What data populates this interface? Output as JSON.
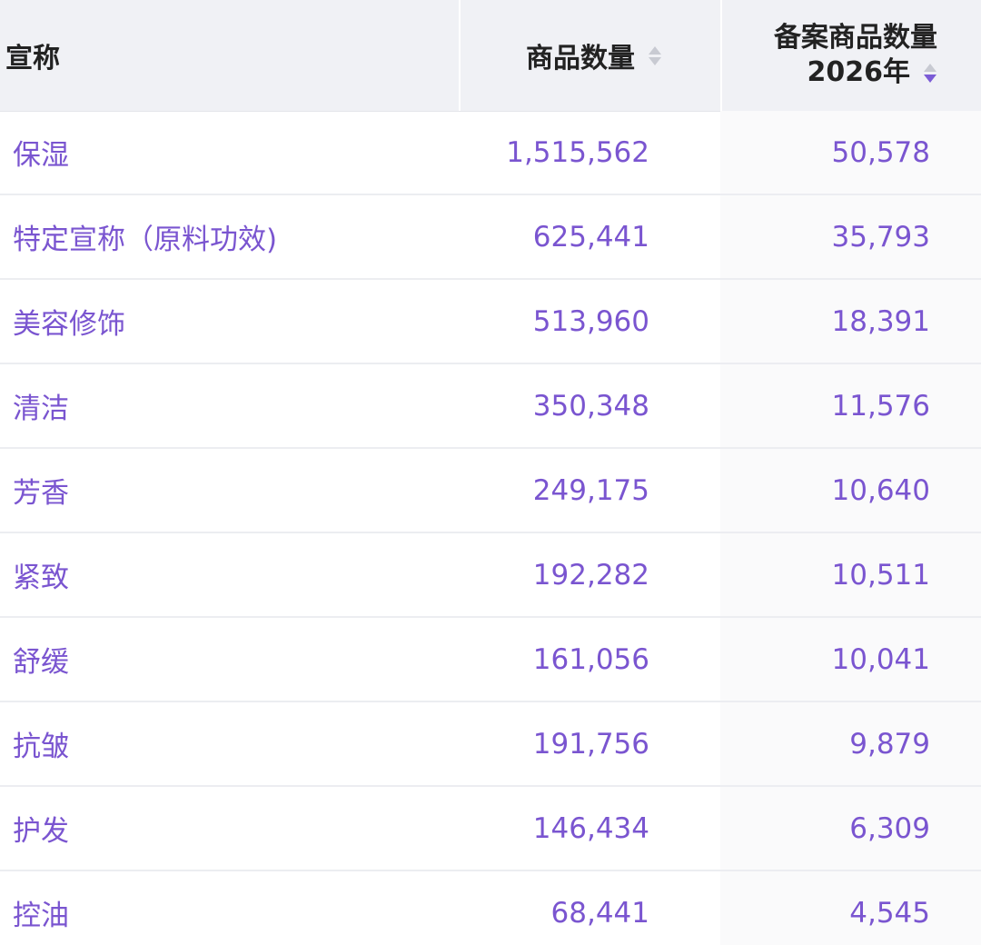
{
  "table": {
    "columns": {
      "claim": "宣称",
      "product_count": "商品数量",
      "filed_product_count_line1": "备案商品数量",
      "filed_product_count_line2": "2026年"
    },
    "sort": {
      "column": "filed_product_count",
      "direction": "descending"
    },
    "rows": [
      {
        "claim": "保湿",
        "product_count": "1,515,562",
        "filed_product_count": "50,578"
      },
      {
        "claim": "特定宣称（原料功效)",
        "product_count": "625,441",
        "filed_product_count": "35,793"
      },
      {
        "claim": "美容修饰",
        "product_count": "513,960",
        "filed_product_count": "18,391"
      },
      {
        "claim": "清洁",
        "product_count": "350,348",
        "filed_product_count": "11,576"
      },
      {
        "claim": "芳香",
        "product_count": "249,175",
        "filed_product_count": "10,640"
      },
      {
        "claim": "紧致",
        "product_count": "192,282",
        "filed_product_count": "10,511"
      },
      {
        "claim": "舒缓",
        "product_count": "161,056",
        "filed_product_count": "10,041"
      },
      {
        "claim": "抗皱",
        "product_count": "191,756",
        "filed_product_count": "9,879"
      },
      {
        "claim": "护发",
        "product_count": "146,434",
        "filed_product_count": "6,309"
      },
      {
        "claim": "控油",
        "product_count": "68,441",
        "filed_product_count": "4,545"
      }
    ]
  },
  "colors": {
    "header_bg": "#f0f1f5",
    "link_text": "#7a55d0",
    "sort_active": "#7b5cd6",
    "sort_inactive": "#c8cad2"
  },
  "icons": {
    "sort_inactive": "sort-icon",
    "sort_active": "sort-desc-icon"
  }
}
